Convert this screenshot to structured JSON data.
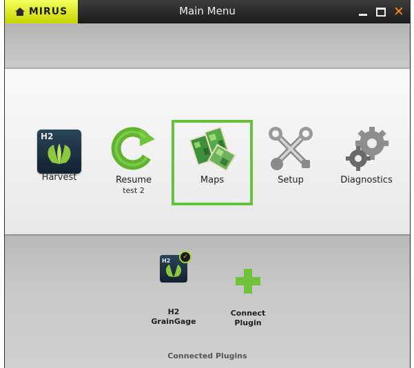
{
  "titlebar": {
    "brand": "MIRUS",
    "title": "Main Menu",
    "controls": {
      "minimize": "minimize-icon",
      "maximize": "maximize-icon",
      "close": "✕"
    }
  },
  "menu": {
    "items": [
      {
        "label": "Harvest",
        "sub": "",
        "icon": "h2-harvest-icon"
      },
      {
        "label": "Resume",
        "sub": "test 2",
        "icon": "resume-arrow-icon"
      },
      {
        "label": "Maps",
        "sub": "",
        "icon": "maps-icon",
        "selected": true
      },
      {
        "label": "Setup",
        "sub": "",
        "icon": "tools-icon"
      },
      {
        "label": "Diagnostics",
        "sub": "",
        "icon": "gears-icon"
      }
    ],
    "h2_badge": "H2"
  },
  "plugins": {
    "items": [
      {
        "line1": "H2",
        "line2": "GrainGage",
        "icon": "h2-graingage-icon"
      },
      {
        "line1": "Connect",
        "line2": "Plugin",
        "icon": "plus-icon"
      }
    ],
    "h2_badge": "H2",
    "caption": "Connected Plugins"
  },
  "colors": {
    "brand_yellow": "#d6e61e",
    "selection_green": "#63c437",
    "close_orange": "#ff8a1c",
    "plus_green": "#6fc23a"
  }
}
